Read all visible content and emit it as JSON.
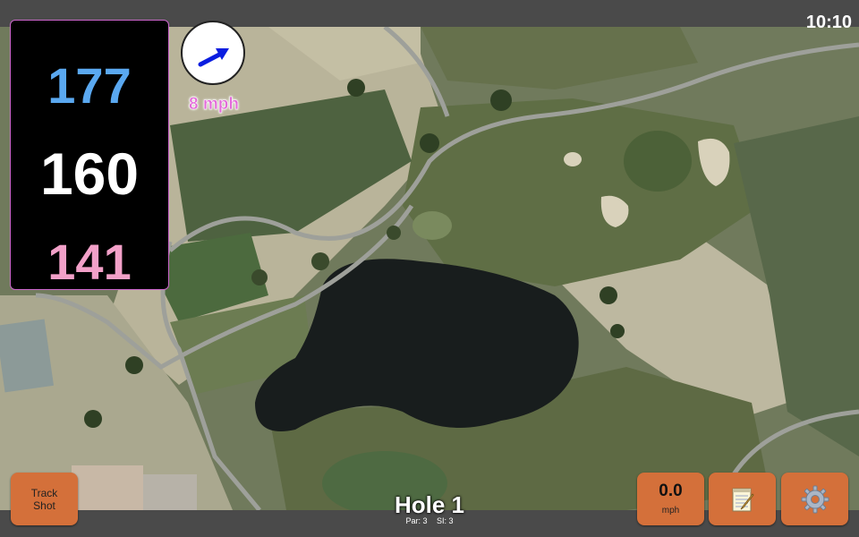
{
  "status": {
    "clock": "10:10"
  },
  "distances": {
    "back": "177",
    "middle": "160",
    "front": "141"
  },
  "colors": {
    "back": "#5aa8f0",
    "middle": "#ffffff",
    "front": "#f2a0c8",
    "button": "#d4703a",
    "wind_arrow": "#0a1de0"
  },
  "wind": {
    "speed_label": "8 mph",
    "icon": "wind-direction-arrow-icon"
  },
  "hole": {
    "title": "Hole 1",
    "par_label": "Par: 3",
    "si_label": "SI: 3"
  },
  "buttons": {
    "track_shot_line1": "Track",
    "track_shot_line2": "Shot",
    "speed_value": "0.0",
    "speed_unit": "mph",
    "notes_icon": "notepad-icon",
    "settings_icon": "gear-icon"
  }
}
